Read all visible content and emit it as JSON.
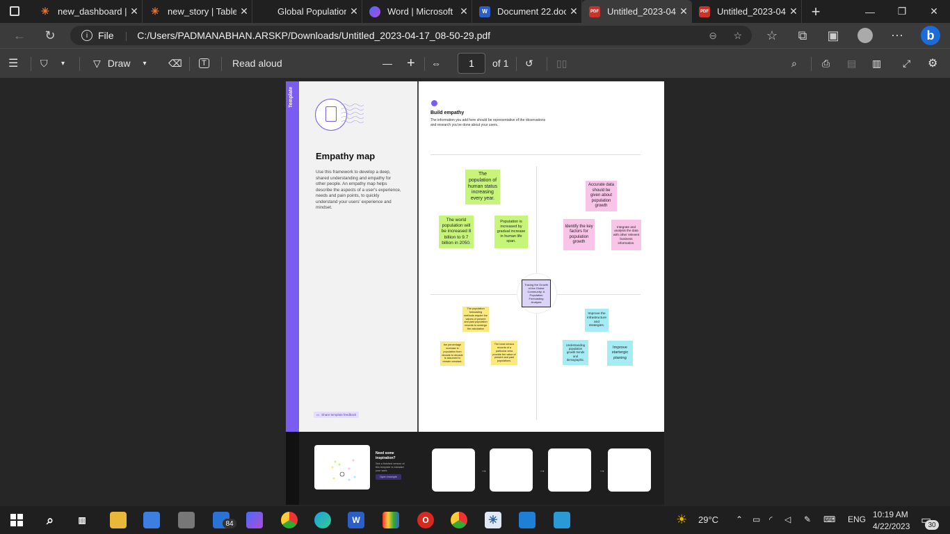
{
  "tabs": [
    {
      "title": "new_dashboard |",
      "icon": "tableau-icon"
    },
    {
      "title": "new_story | Table",
      "icon": "tableau-icon"
    },
    {
      "title": "Global Population",
      "icon": "powerbi-icon"
    },
    {
      "title": "Word | Microsoft",
      "icon": "m365-icon"
    },
    {
      "title": "Document 22.doc",
      "icon": "word-icon"
    },
    {
      "title": "Untitled_2023-04",
      "icon": "pdf-icon"
    },
    {
      "title": "Untitled_2023-04",
      "icon": "pdf-icon"
    }
  ],
  "address": {
    "file_label": "File",
    "url": "C:/Users/PADMANABHAN.ARSKP/Downloads/Untitled_2023-04-17_08-50-29.pdf"
  },
  "pdf_toolbar": {
    "draw_label": "Draw",
    "read_aloud_label": "Read aloud",
    "page_number": "1",
    "page_total": "of 1"
  },
  "document": {
    "side_tab_label": "Template",
    "title": "Empathy map",
    "description": "Use this framework to develop a deep, shared understanding and empathy for other people. An empathy map helps describe the aspects of a user's experience, needs and pain points, to quickly understand your users' experience and mindset.",
    "feedback_link": "Share template feedback",
    "section_title": "Build empathy",
    "section_text": "The information you add here should be representative of the observations and research you've done about your users.",
    "center_box": "Tracing the Growth of the Global Community: A Population Forecasting Analysis",
    "notes": {
      "g1": "The population of human status increasing every year.",
      "g2": "The world population will be increased 8 billion to 9.7 billion in 2050.",
      "g3": "Population is increased by gradual increase in human life span.",
      "p1": "Accurate data should be given about population growth",
      "p2": "Identify the key factors for population growth",
      "p3": "Integrate and analysis the data with other relevent business information.",
      "y1": "The population forecasting methods require the values of present and past population records to undergo the calculation",
      "y2": "the percentage increase in population from decade to decade is assumed to remain constant.",
      "y3": "The local census records of a particular area provide the value of present and past populations.",
      "b1": "Improve the infrastructure and strategies.",
      "b2": "Understanding population growth trends and demographic.",
      "b3": "Improve startergic planing"
    },
    "inspiration": {
      "heading": "Need some inspiration?",
      "text": "See a finished version of this template to kickstart your work.",
      "button": "Open example"
    }
  },
  "taskbar": {
    "temperature": "29°C",
    "language": "ENG",
    "time": "10:19 AM",
    "date": "4/22/2023",
    "mail_badge": "84",
    "notif_badge": "30"
  }
}
